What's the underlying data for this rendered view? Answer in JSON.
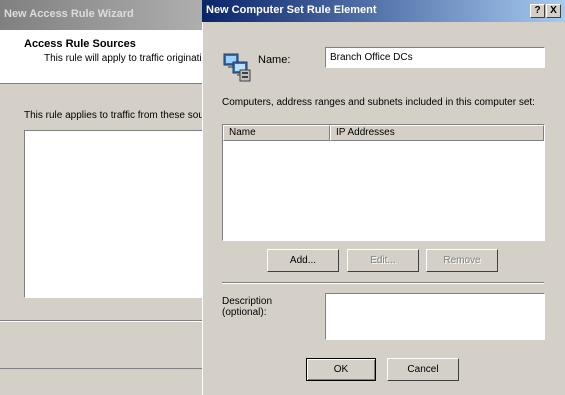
{
  "wizard": {
    "title": "New Access Rule Wizard",
    "heading": "Access Rule Sources",
    "subtitle": "This rule will apply to traffic originati",
    "applies_text": "This rule applies to traffic from these sou"
  },
  "dialog": {
    "title": "New Computer Set Rule Element",
    "help_label": "?",
    "close_label": "X",
    "name_label": "Name:",
    "name_value": "Branch Office DCs",
    "list_caption": "Computers, address ranges and subnets included in this computer set:",
    "columns": [
      "Name",
      "IP Addresses"
    ],
    "add_label": "Add...",
    "edit_label": "Edit...",
    "remove_label": "Remove",
    "description_label_line1": "Description",
    "description_label_line2": "(optional):",
    "ok_label": "OK",
    "cancel_label": "Cancel"
  },
  "icons": {
    "computer_set": "computer-set-icon"
  }
}
